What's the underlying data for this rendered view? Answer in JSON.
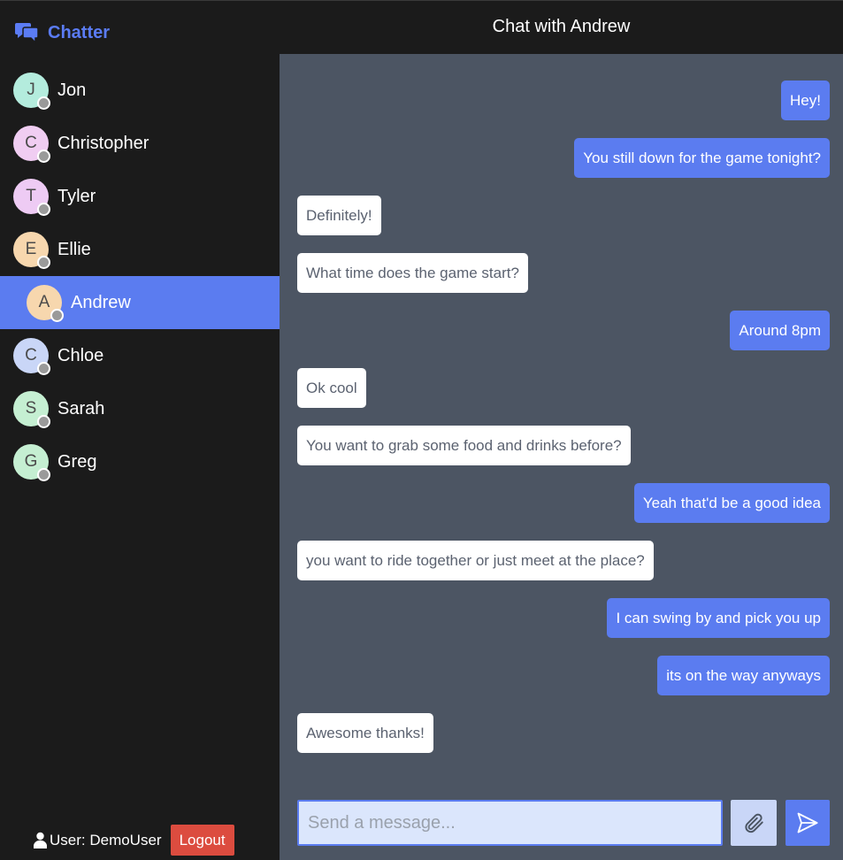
{
  "app": {
    "name": "Chatter",
    "accent_color": "#5b7cf0"
  },
  "sidebar": {
    "contacts": [
      {
        "initial": "J",
        "name": "Jon",
        "avatar_color": "#b4ecdd",
        "status": "offline"
      },
      {
        "initial": "C",
        "name": "Christopher",
        "avatar_color": "#f0cdf2",
        "status": "offline"
      },
      {
        "initial": "T",
        "name": "Tyler",
        "avatar_color": "#eecbf4",
        "status": "offline"
      },
      {
        "initial": "E",
        "name": "Ellie",
        "avatar_color": "#f7d7ae",
        "status": "offline"
      },
      {
        "initial": "A",
        "name": "Andrew",
        "avatar_color": "#f7d7ae",
        "status": "offline",
        "active": true
      },
      {
        "initial": "C",
        "name": "Chloe",
        "avatar_color": "#c9d6f7",
        "status": "offline"
      },
      {
        "initial": "S",
        "name": "Sarah",
        "avatar_color": "#c5efd2",
        "status": "offline"
      },
      {
        "initial": "G",
        "name": "Greg",
        "avatar_color": "#c5efd2",
        "status": "offline"
      }
    ],
    "user_label": "User: DemoUser",
    "logout_label": "Logout"
  },
  "header": {
    "title": "Chat with Andrew"
  },
  "messages": [
    {
      "direction": "sent",
      "text": "Hey!"
    },
    {
      "direction": "sent",
      "text": "You still down for the game tonight?"
    },
    {
      "direction": "received",
      "text": "Definitely!"
    },
    {
      "direction": "received",
      "text": "What time does the game start?"
    },
    {
      "direction": "sent",
      "text": "Around 8pm"
    },
    {
      "direction": "received",
      "text": "Ok cool"
    },
    {
      "direction": "received",
      "text": "You want to grab some food and drinks before?"
    },
    {
      "direction": "sent",
      "text": "Yeah that'd be a good idea"
    },
    {
      "direction": "received",
      "text": "you want to ride together or just meet at the place?"
    },
    {
      "direction": "sent",
      "text": "I can swing by and pick you up"
    },
    {
      "direction": "sent",
      "text": "its on the way anyways"
    },
    {
      "direction": "received",
      "text": "Awesome thanks!"
    }
  ],
  "composer": {
    "value": "",
    "placeholder": "Send a message...",
    "attach_icon": "paperclip-icon",
    "send_icon": "send-icon"
  }
}
